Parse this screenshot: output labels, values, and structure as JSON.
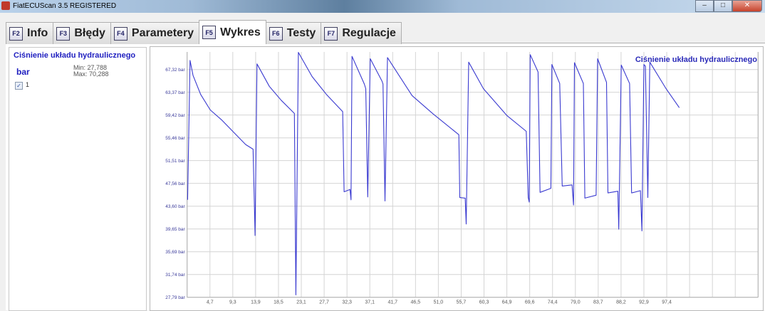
{
  "window": {
    "title": "FiatECUScan 3.5 REGISTERED",
    "min_label": "–",
    "max_label": "□",
    "close_label": "✕"
  },
  "tabs": [
    {
      "key": "F2",
      "label": "Info",
      "active": false
    },
    {
      "key": "F3",
      "label": "Błędy",
      "active": false
    },
    {
      "key": "F4",
      "label": "Parametery",
      "active": false
    },
    {
      "key": "F5",
      "label": "Wykres",
      "active": true
    },
    {
      "key": "F6",
      "label": "Testy",
      "active": false
    },
    {
      "key": "F7",
      "label": "Regulacje",
      "active": false
    }
  ],
  "left_panel": {
    "title": "Ciśnienie układu hydraulicznego",
    "unit": "bar",
    "min": "Min: 27,788",
    "max": "Max: 70,288",
    "series_label": "1",
    "series_checked": true
  },
  "chart_data": {
    "type": "line",
    "title": "Ciśnienie układu hydraulicznego",
    "legend": "top-right",
    "grid": true,
    "line_color": "#3a3ad0",
    "xlim": [
      0,
      116
    ],
    "ylim": [
      27.79,
      70.37
    ],
    "x_ticks": [
      "4,7",
      "9,3",
      "13,9",
      "18,5",
      "23,1",
      "27,7",
      "32,3",
      "37,1",
      "41,7",
      "46,5",
      "51,0",
      "55,7",
      "60,3",
      "64,9",
      "69,6",
      "74,4",
      "79,0",
      "83,7",
      "88,2",
      "92,9",
      "97,4"
    ],
    "x_tick_values": [
      4.63,
      9.26,
      13.89,
      18.52,
      23.15,
      27.78,
      32.41,
      37.04,
      41.67,
      46.3,
      50.93,
      55.56,
      60.19,
      64.82,
      69.45,
      74.08,
      78.71,
      83.34,
      87.97,
      92.6,
      97.23
    ],
    "x_gridlines": 25,
    "y_ticks": [
      "27,79 bar",
      "31,74 bar",
      "35,69 bar",
      "39,65 bar",
      "43,60 bar",
      "47,56 bar",
      "51,51 bar",
      "55,46 bar",
      "59,42 bar",
      "63,37 bar",
      "67,32 bar"
    ],
    "y_tick_values": [
      27.79,
      31.74,
      35.69,
      39.65,
      43.6,
      47.56,
      51.51,
      55.46,
      59.42,
      63.37,
      67.32
    ],
    "series": [
      {
        "name": "Ciśnienie układu hydraulicznego",
        "x": [
          0.1,
          0.6,
          1.2,
          2.75,
          4.7,
          7.1,
          9.5,
          11.9,
          13.4,
          13.8,
          14.2,
          16.7,
          19.1,
          21.8,
          22.1,
          22.6,
          25.4,
          28.3,
          31.6,
          31.9,
          33.1,
          33.3,
          33.5,
          36.0,
          36.3,
          36.7,
          37.2,
          39.6,
          39.8,
          40.2,
          40.7,
          45.7,
          50.0,
          55.2,
          55.4,
          56.5,
          56.7,
          57.2,
          60.2,
          65.0,
          68.9,
          69.3,
          69.5,
          69.7,
          71.3,
          71.7,
          73.9,
          74.1,
          75.7,
          76.2,
          78.2,
          78.5,
          78.7,
          80.5,
          80.8,
          83.1,
          83.4,
          85.2,
          85.5,
          87.5,
          87.7,
          88.2,
          89.9,
          90.3,
          92.1,
          92.4,
          92.8,
          93.1,
          93.6,
          94.0,
          97.3,
          100.0
        ],
        "y": [
          44.7,
          68.9,
          66.3,
          63.0,
          60.3,
          58.5,
          56.4,
          54.3,
          53.5,
          38.5,
          68.3,
          64.4,
          62.0,
          59.7,
          28.2,
          70.3,
          66.1,
          63.0,
          60.0,
          46.1,
          46.5,
          44.7,
          69.6,
          64.8,
          64.0,
          45.2,
          69.2,
          65.3,
          64.8,
          44.5,
          69.4,
          62.8,
          59.6,
          56.0,
          45.1,
          45.0,
          40.5,
          68.6,
          64.0,
          59.3,
          56.6,
          45.1,
          44.3,
          69.9,
          66.9,
          46.0,
          46.7,
          68.2,
          64.9,
          47.1,
          47.3,
          43.8,
          68.5,
          64.9,
          45.0,
          45.5,
          69.2,
          65.1,
          45.9,
          46.2,
          39.6,
          68.1,
          64.9,
          45.9,
          46.3,
          39.3,
          68.2,
          67.9,
          45.1,
          68.6,
          64.0,
          60.7
        ]
      }
    ]
  }
}
